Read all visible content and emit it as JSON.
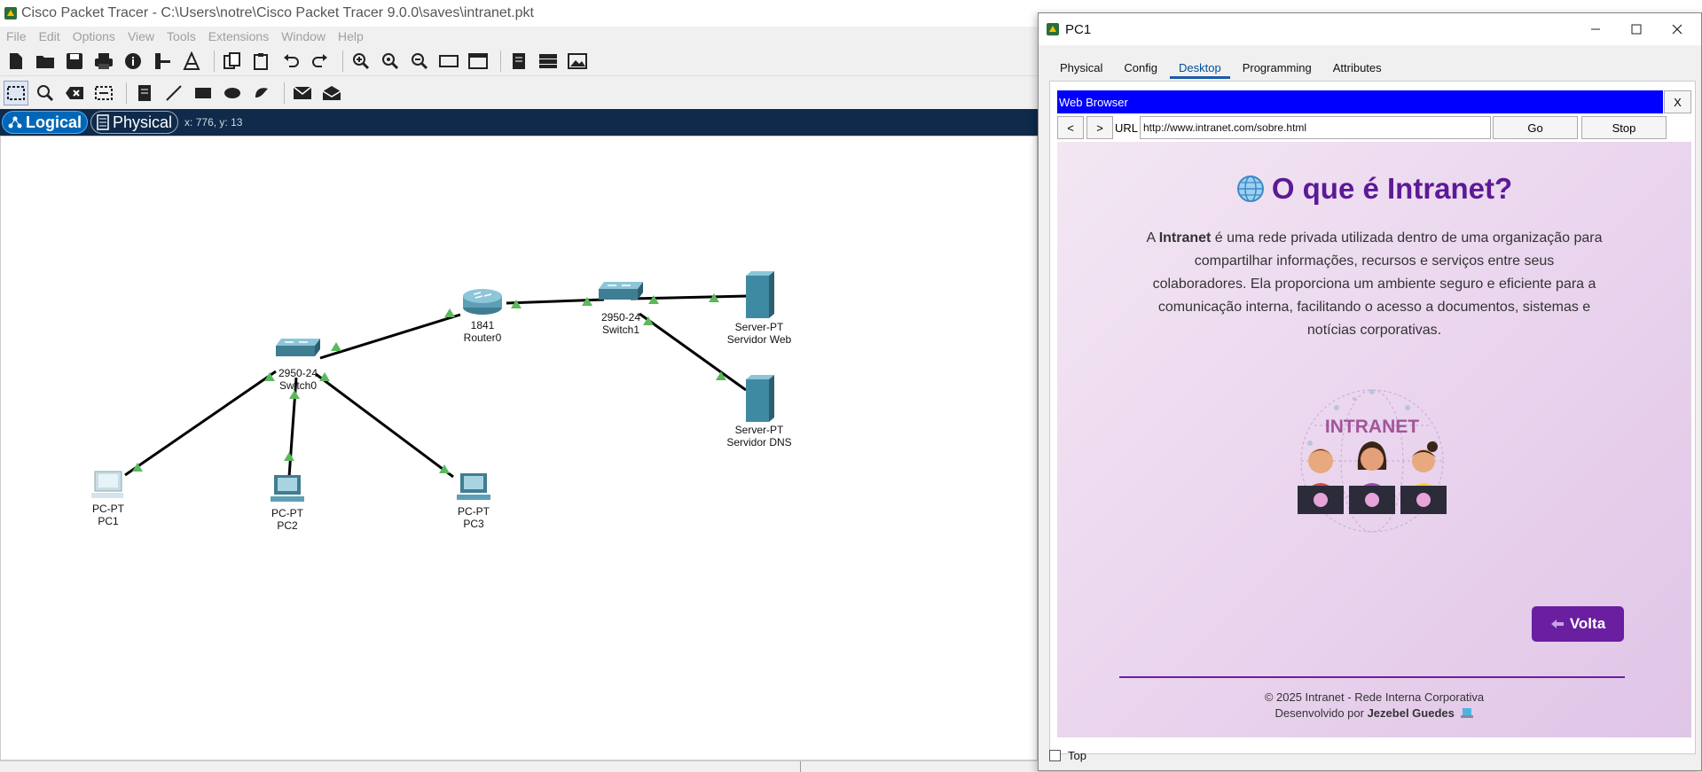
{
  "window": {
    "title": "Cisco Packet Tracer - C:\\Users\\notre\\Cisco Packet Tracer 9.0.0\\saves\\intranet.pkt"
  },
  "menu": [
    "File",
    "Edit",
    "Options",
    "View",
    "Tools",
    "Extensions",
    "Window",
    "Help"
  ],
  "modebar": {
    "logical_label": "Logical",
    "physical_label": "Physical",
    "coords": "x: 776, y: 13"
  },
  "devices": [
    {
      "id": "router0",
      "model": "1841",
      "name": "Router0"
    },
    {
      "id": "switch1",
      "model": "2950-24",
      "name": "Switch1"
    },
    {
      "id": "switch0",
      "model": "2950-24",
      "name": "Switch0"
    },
    {
      "id": "server-web",
      "model": "Server-PT",
      "name": "Servidor Web"
    },
    {
      "id": "server-dns",
      "model": "Server-PT",
      "name": "Servidor DNS"
    },
    {
      "id": "pc1",
      "model": "PC-PT",
      "name": "PC1"
    },
    {
      "id": "pc2",
      "model": "PC-PT",
      "name": "PC2"
    },
    {
      "id": "pc3",
      "model": "PC-PT",
      "name": "PC3"
    }
  ],
  "dialog": {
    "title": "PC1",
    "tabs": [
      "Physical",
      "Config",
      "Desktop",
      "Programming",
      "Attributes"
    ],
    "active_tab": "Desktop",
    "top_checkbox_label": "Top",
    "browser": {
      "title": "Web Browser",
      "close_label": "X",
      "back_label": "<",
      "forward_label": ">",
      "url_label": "URL",
      "url_value": "http://www.intranet.com/sobre.html",
      "go_label": "Go",
      "stop_label": "Stop"
    },
    "page": {
      "heading": "O que é Intranet?",
      "paragraph_pre": "A ",
      "paragraph_bold": "Intranet",
      "paragraph_post": " é uma rede privada utilizada dentro de uma organização para compartilhar informações, recursos e serviços entre seus colaboradores. Ela proporciona um ambiente seguro e eficiente para a comunicação interna, facilitando o acesso a documentos, sistemas e notícias corporativas.",
      "illustration_text": "INTRANET",
      "volta_label": "Volta",
      "footer_line1": "© 2025 Intranet - Rede Interna Corporativa",
      "footer_line2_pre": "Desenvolvido por ",
      "footer_author": "Jezebel Guedes"
    }
  },
  "colors": {
    "accent_purple": "#6a1fa0",
    "heading_purple": "#5b1a96",
    "browser_titlebar": "#0000ff",
    "link_green": "#5cb85c",
    "modebar_bg": "#0f2a4a"
  }
}
